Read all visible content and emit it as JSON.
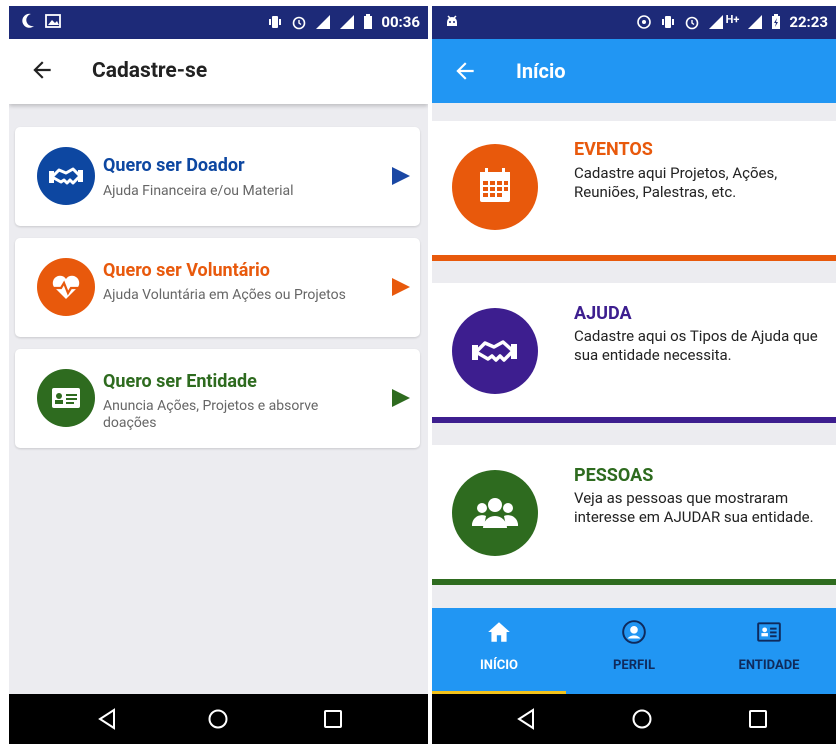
{
  "left_screen": {
    "status_bar": {
      "time": "00:36"
    },
    "app_bar": {
      "title": "Cadastre-se"
    },
    "options": [
      {
        "title": "Quero ser Doador",
        "subtitle": "Ajuda Financeira e/ou Material",
        "icon": "handshake-icon",
        "color": "#0d47a1"
      },
      {
        "title": "Quero ser Voluntário",
        "subtitle": "Ajuda Voluntária em Ações ou Projetos",
        "icon": "heart-pulse-icon",
        "color": "#e8590c"
      },
      {
        "title": "Quero ser Entidade",
        "subtitle": "Anuncia Ações, Projetos e absorve doações",
        "icon": "id-card-icon",
        "color": "#2e6b1f"
      }
    ]
  },
  "right_screen": {
    "status_bar": {
      "time": "22:23",
      "network": "H+"
    },
    "app_bar": {
      "title": "Início"
    },
    "cards": [
      {
        "title": "EVENTOS",
        "description": "Cadastre aqui Projetos, Ações, Reuniões, Palestras, etc.",
        "icon": "calendar-icon",
        "color": "#e8590c"
      },
      {
        "title": "AJUDA",
        "description": "Cadastre aqui os Tipos de Ajuda que sua entidade necessita.",
        "icon": "handshake-icon",
        "color": "#3d1e8f"
      },
      {
        "title": "PESSOAS",
        "description": "Veja as pessoas que mostraram interesse em AJUDAR sua entidade.",
        "icon": "people-icon",
        "color": "#2e6b1f"
      }
    ],
    "bottom_nav": {
      "active": "INÍCIO",
      "tabs": [
        {
          "label": "INÍCIO",
          "icon": "home-icon"
        },
        {
          "label": "PERFIL",
          "icon": "profile-icon"
        },
        {
          "label": "ENTIDADE",
          "icon": "id-card-icon"
        }
      ]
    }
  },
  "colors": {
    "primary_blue": "#2196f3",
    "status_bar": "#1d2a78",
    "tab_active_indicator": "#f4c21a"
  }
}
